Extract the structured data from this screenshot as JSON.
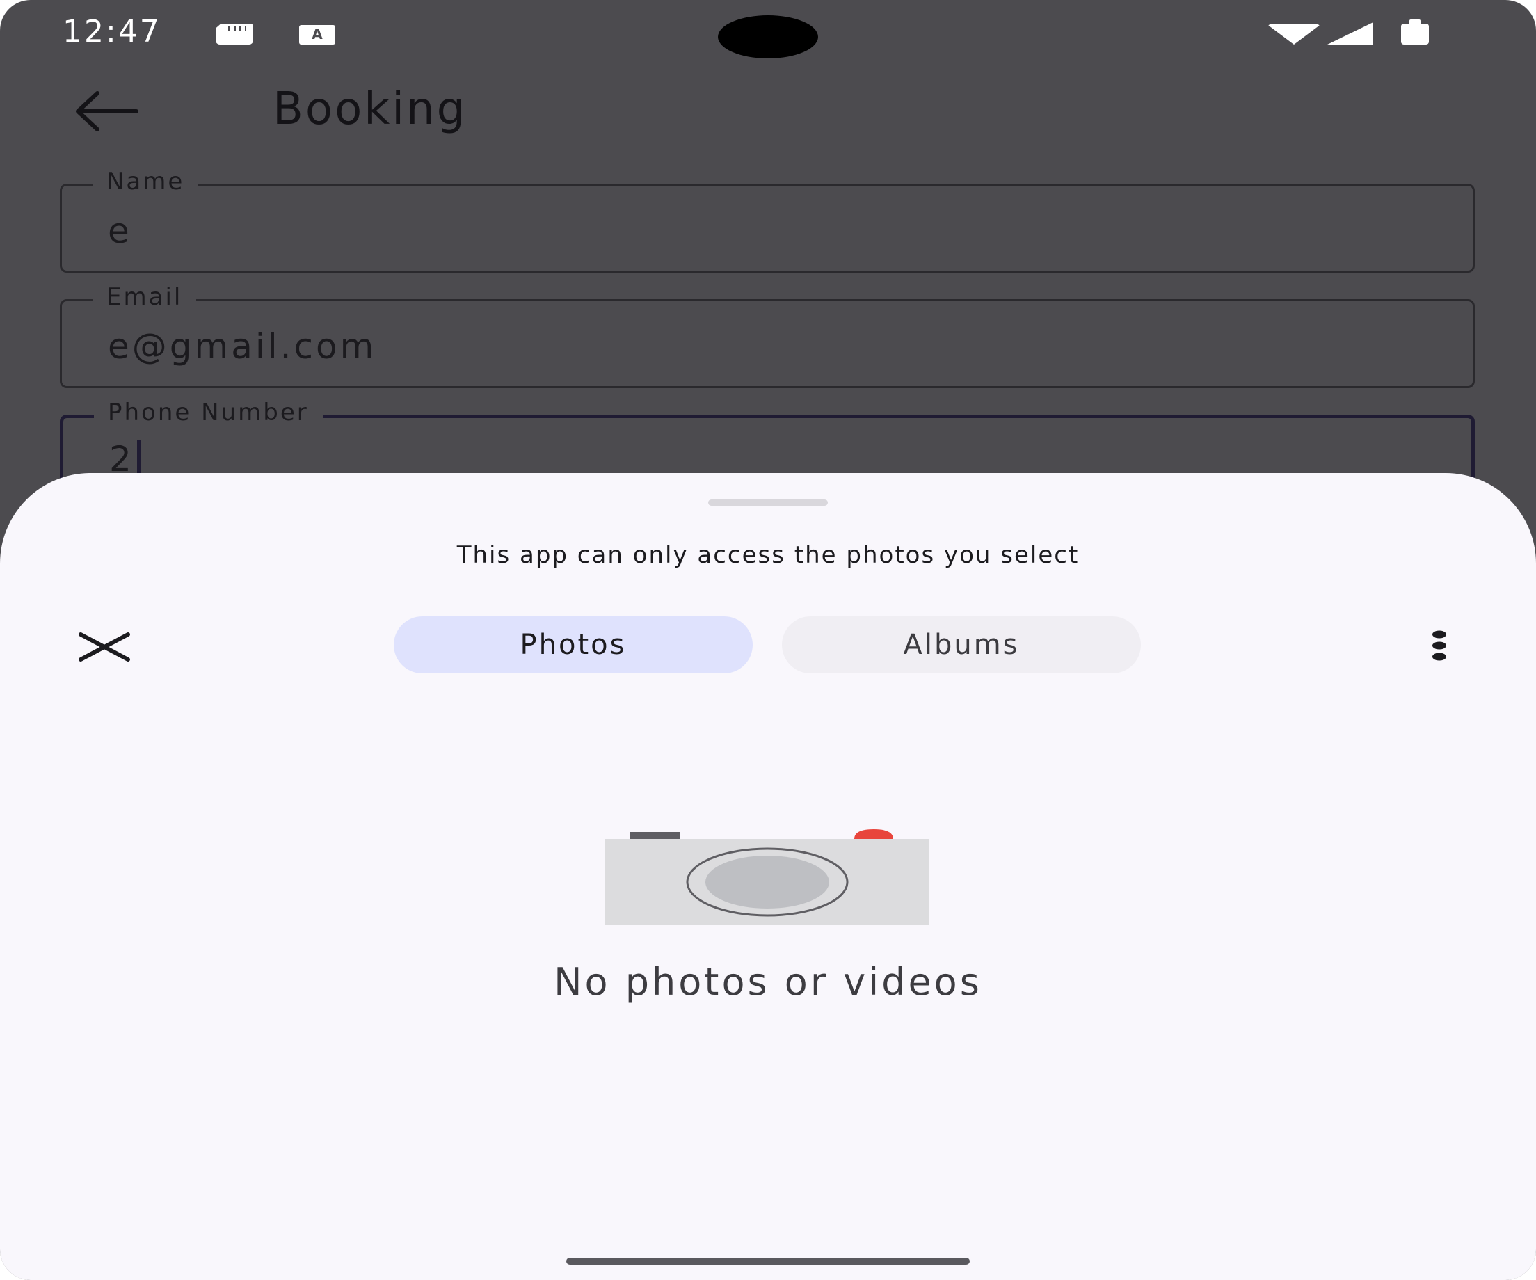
{
  "status_bar": {
    "time": "12:47",
    "icons": [
      "sd-card-icon",
      "accessibility-a-icon",
      "wifi-icon",
      "cellular-signal-icon",
      "battery-icon"
    ],
    "a_icon_text": "A"
  },
  "app_bar": {
    "title": "Booking",
    "back_icon": "arrow-back-icon"
  },
  "form": {
    "name": {
      "label": "Name",
      "value": "e"
    },
    "email": {
      "label": "Email",
      "value": "e@gmail.com"
    },
    "phone": {
      "label": "Phone Number",
      "value": "2"
    }
  },
  "photo_picker": {
    "subtitle": "This app can only access the photos you select",
    "close_icon": "close-icon",
    "tabs": [
      {
        "label": "Photos",
        "selected": true
      },
      {
        "label": "Albums",
        "selected": false
      }
    ],
    "more_icon": "more-vertical-icon",
    "empty_state": {
      "icon": "camera-icon",
      "text": "No photos or videos"
    }
  },
  "colors": {
    "scrim_background": "#4c4b4f",
    "sheet_background": "#f9f7fc",
    "selected_tab": "#dfe2fd",
    "unselected_tab": "#f0eef3",
    "camera_accent": "#e8453c"
  }
}
